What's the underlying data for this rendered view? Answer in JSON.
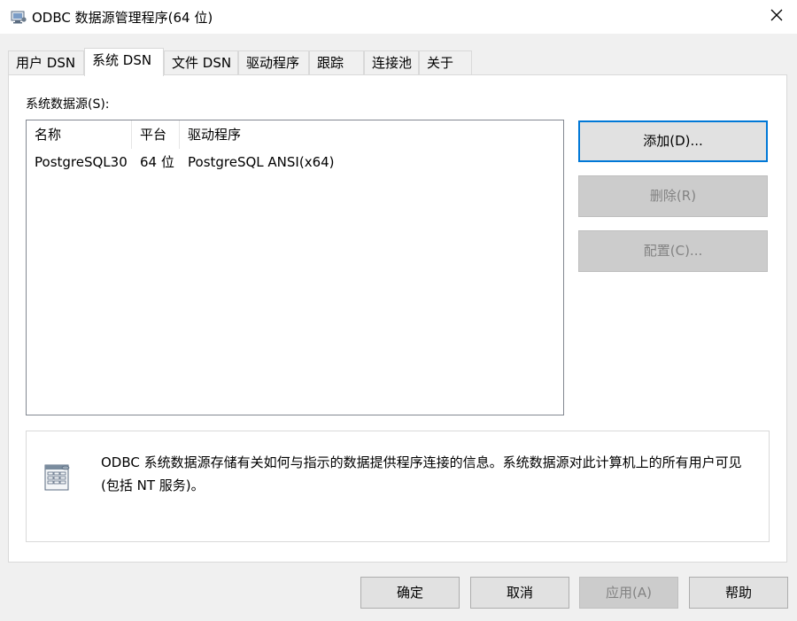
{
  "window": {
    "title": "ODBC 数据源管理程序(64 位)"
  },
  "tabs": [
    {
      "label": "用户 DSN",
      "active": false
    },
    {
      "label": "系统 DSN",
      "active": true
    },
    {
      "label": "文件 DSN",
      "active": false
    },
    {
      "label": "驱动程序",
      "active": false
    },
    {
      "label": "跟踪",
      "active": false
    },
    {
      "label": "连接池",
      "active": false
    },
    {
      "label": "关于",
      "active": false
    }
  ],
  "system_dsn": {
    "section_label": "系统数据源(S):",
    "columns": [
      "名称",
      "平台",
      "驱动程序"
    ],
    "rows": [
      {
        "name": "PostgreSQL30",
        "platform": "64 位",
        "driver": "PostgreSQL ANSI(x64)"
      }
    ],
    "buttons": {
      "add": "添加(D)...",
      "remove": "删除(R)",
      "configure": "配置(C)..."
    },
    "info_text": "ODBC 系统数据源存储有关如何与指示的数据提供程序连接的信息。系统数据源对此计算机上的所有用户可见(包括 NT 服务)。"
  },
  "footer": {
    "ok": "确定",
    "cancel": "取消",
    "apply": "应用(A)",
    "help": "帮助"
  },
  "icons": {
    "title": "odbc-app-icon",
    "close": "close-icon",
    "info": "data-sources-icon"
  },
  "colors": {
    "accent": "#0078d7",
    "window_bg": "#f0f0f0",
    "disabled_text": "#838383"
  }
}
